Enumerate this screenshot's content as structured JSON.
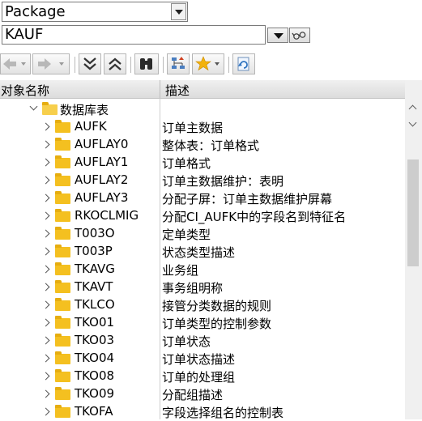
{
  "object_type_select": {
    "value": "Package"
  },
  "search": {
    "value": "KAUF"
  },
  "columns": {
    "object_name": "对象名称",
    "description": "描述"
  },
  "tree": {
    "root": {
      "label": "数据库表"
    },
    "items": [
      {
        "name": "AUFK",
        "desc": "订单主数据"
      },
      {
        "name": "AUFLAY0",
        "desc": "整体表：订单格式"
      },
      {
        "name": "AUFLAY1",
        "desc": "订单格式"
      },
      {
        "name": "AUFLAY2",
        "desc": "订单主数据维护：表明"
      },
      {
        "name": "AUFLAY3",
        "desc": "分配子屏：订单主数据维护屏幕"
      },
      {
        "name": "RKOCLMIG",
        "desc": "分配CI_AUFK中的字段名到特征名"
      },
      {
        "name": "T003O",
        "desc": "定单类型"
      },
      {
        "name": "T003P",
        "desc": "状态类型描述"
      },
      {
        "name": "TKAVG",
        "desc": "业务组"
      },
      {
        "name": "TKAVT",
        "desc": "事务组明称"
      },
      {
        "name": "TKLCO",
        "desc": "接管分类数据的规则"
      },
      {
        "name": "TKO01",
        "desc": "订单类型的控制参数"
      },
      {
        "name": "TKO03",
        "desc": "订单状态"
      },
      {
        "name": "TKO04",
        "desc": "订单状态描述"
      },
      {
        "name": "TKO08",
        "desc": "订单的处理组"
      },
      {
        "name": "TKO09",
        "desc": "分配组描述"
      },
      {
        "name": "TKOFA",
        "desc": "字段选择组名的控制表"
      }
    ]
  },
  "icons": {
    "back": "back-arrow-icon",
    "forward": "forward-arrow-icon",
    "expand_all": "expand-all-icon",
    "collapse_all": "collapse-all-icon",
    "find": "binoculars-icon",
    "hierarchy": "hierarchy-sort-icon",
    "favorites": "favorites-star-icon",
    "refresh": "refresh-icon",
    "folder_color": "#f4c020"
  }
}
